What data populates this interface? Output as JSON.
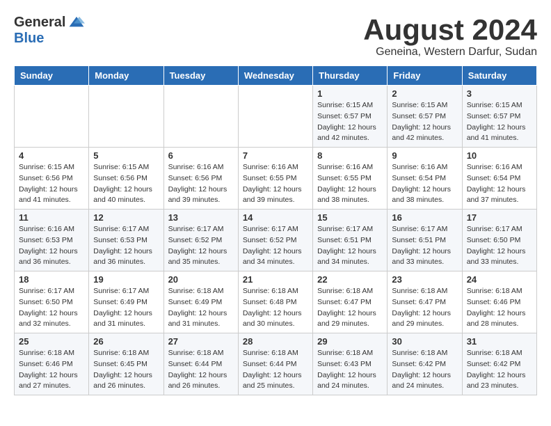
{
  "logo": {
    "general": "General",
    "blue": "Blue"
  },
  "title": "August 2024",
  "subtitle": "Geneina, Western Darfur, Sudan",
  "days_of_week": [
    "Sunday",
    "Monday",
    "Tuesday",
    "Wednesday",
    "Thursday",
    "Friday",
    "Saturday"
  ],
  "weeks": [
    [
      {
        "day": "",
        "info": ""
      },
      {
        "day": "",
        "info": ""
      },
      {
        "day": "",
        "info": ""
      },
      {
        "day": "",
        "info": ""
      },
      {
        "day": "1",
        "sunrise": "6:15 AM",
        "sunset": "6:57 PM",
        "daylight": "12 hours and 42 minutes."
      },
      {
        "day": "2",
        "sunrise": "6:15 AM",
        "sunset": "6:57 PM",
        "daylight": "12 hours and 42 minutes."
      },
      {
        "day": "3",
        "sunrise": "6:15 AM",
        "sunset": "6:57 PM",
        "daylight": "12 hours and 41 minutes."
      }
    ],
    [
      {
        "day": "4",
        "sunrise": "6:15 AM",
        "sunset": "6:56 PM",
        "daylight": "12 hours and 41 minutes."
      },
      {
        "day": "5",
        "sunrise": "6:15 AM",
        "sunset": "6:56 PM",
        "daylight": "12 hours and 40 minutes."
      },
      {
        "day": "6",
        "sunrise": "6:16 AM",
        "sunset": "6:56 PM",
        "daylight": "12 hours and 39 minutes."
      },
      {
        "day": "7",
        "sunrise": "6:16 AM",
        "sunset": "6:55 PM",
        "daylight": "12 hours and 39 minutes."
      },
      {
        "day": "8",
        "sunrise": "6:16 AM",
        "sunset": "6:55 PM",
        "daylight": "12 hours and 38 minutes."
      },
      {
        "day": "9",
        "sunrise": "6:16 AM",
        "sunset": "6:54 PM",
        "daylight": "12 hours and 38 minutes."
      },
      {
        "day": "10",
        "sunrise": "6:16 AM",
        "sunset": "6:54 PM",
        "daylight": "12 hours and 37 minutes."
      }
    ],
    [
      {
        "day": "11",
        "sunrise": "6:16 AM",
        "sunset": "6:53 PM",
        "daylight": "12 hours and 36 minutes."
      },
      {
        "day": "12",
        "sunrise": "6:17 AM",
        "sunset": "6:53 PM",
        "daylight": "12 hours and 36 minutes."
      },
      {
        "day": "13",
        "sunrise": "6:17 AM",
        "sunset": "6:52 PM",
        "daylight": "12 hours and 35 minutes."
      },
      {
        "day": "14",
        "sunrise": "6:17 AM",
        "sunset": "6:52 PM",
        "daylight": "12 hours and 34 minutes."
      },
      {
        "day": "15",
        "sunrise": "6:17 AM",
        "sunset": "6:51 PM",
        "daylight": "12 hours and 34 minutes."
      },
      {
        "day": "16",
        "sunrise": "6:17 AM",
        "sunset": "6:51 PM",
        "daylight": "12 hours and 33 minutes."
      },
      {
        "day": "17",
        "sunrise": "6:17 AM",
        "sunset": "6:50 PM",
        "daylight": "12 hours and 33 minutes."
      }
    ],
    [
      {
        "day": "18",
        "sunrise": "6:17 AM",
        "sunset": "6:50 PM",
        "daylight": "12 hours and 32 minutes."
      },
      {
        "day": "19",
        "sunrise": "6:17 AM",
        "sunset": "6:49 PM",
        "daylight": "12 hours and 31 minutes."
      },
      {
        "day": "20",
        "sunrise": "6:18 AM",
        "sunset": "6:49 PM",
        "daylight": "12 hours and 31 minutes."
      },
      {
        "day": "21",
        "sunrise": "6:18 AM",
        "sunset": "6:48 PM",
        "daylight": "12 hours and 30 minutes."
      },
      {
        "day": "22",
        "sunrise": "6:18 AM",
        "sunset": "6:47 PM",
        "daylight": "12 hours and 29 minutes."
      },
      {
        "day": "23",
        "sunrise": "6:18 AM",
        "sunset": "6:47 PM",
        "daylight": "12 hours and 29 minutes."
      },
      {
        "day": "24",
        "sunrise": "6:18 AM",
        "sunset": "6:46 PM",
        "daylight": "12 hours and 28 minutes."
      }
    ],
    [
      {
        "day": "25",
        "sunrise": "6:18 AM",
        "sunset": "6:46 PM",
        "daylight": "12 hours and 27 minutes."
      },
      {
        "day": "26",
        "sunrise": "6:18 AM",
        "sunset": "6:45 PM",
        "daylight": "12 hours and 26 minutes."
      },
      {
        "day": "27",
        "sunrise": "6:18 AM",
        "sunset": "6:44 PM",
        "daylight": "12 hours and 26 minutes."
      },
      {
        "day": "28",
        "sunrise": "6:18 AM",
        "sunset": "6:44 PM",
        "daylight": "12 hours and 25 minutes."
      },
      {
        "day": "29",
        "sunrise": "6:18 AM",
        "sunset": "6:43 PM",
        "daylight": "12 hours and 24 minutes."
      },
      {
        "day": "30",
        "sunrise": "6:18 AM",
        "sunset": "6:42 PM",
        "daylight": "12 hours and 24 minutes."
      },
      {
        "day": "31",
        "sunrise": "6:18 AM",
        "sunset": "6:42 PM",
        "daylight": "12 hours and 23 minutes."
      }
    ]
  ],
  "labels": {
    "sunrise": "Sunrise:",
    "sunset": "Sunset:",
    "daylight": "Daylight:"
  }
}
